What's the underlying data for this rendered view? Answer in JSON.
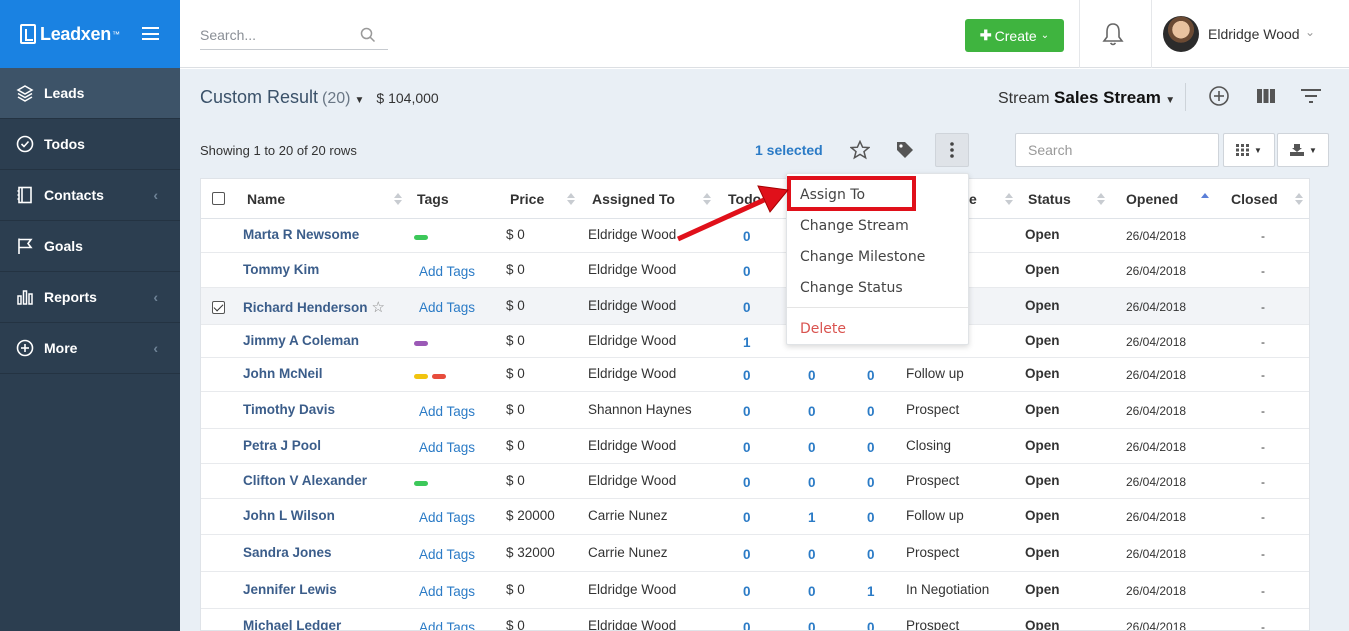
{
  "brand": {
    "name": "Leadxen",
    "tm": "™"
  },
  "sidebar": {
    "items": [
      {
        "label": "Leads",
        "icon": "layers-icon",
        "active": true
      },
      {
        "label": "Todos",
        "icon": "check-circle-icon",
        "active": false
      },
      {
        "label": "Contacts",
        "icon": "contact-book-icon",
        "active": false,
        "expandable": true
      },
      {
        "label": "Goals",
        "icon": "flag-icon",
        "active": false
      },
      {
        "label": "Reports",
        "icon": "bar-chart-icon",
        "active": false,
        "expandable": true
      },
      {
        "label": "More",
        "icon": "plus-circle-icon",
        "active": false,
        "expandable": true
      }
    ]
  },
  "topbar": {
    "search_placeholder": "Search...",
    "create_label": "Create",
    "user_name": "Eldridge Wood"
  },
  "header": {
    "title": "Custom Result",
    "count": "(20)",
    "amount": "$ 104,000",
    "stream_prefix": "Stream",
    "stream_name": "Sales Stream"
  },
  "toolbar": {
    "showing": "Showing 1 to 20 of 20 rows",
    "selected": "1 selected",
    "search_placeholder": "Search"
  },
  "table": {
    "columns": [
      "Name",
      "Tags",
      "Price",
      "Assigned To",
      "Todo",
      "",
      "",
      "Milestone",
      "Status",
      "Opened",
      "Closed"
    ],
    "column_labels": {
      "name": "Name",
      "tags": "Tags",
      "price": "Price",
      "assigned": "Assigned To",
      "todo": "Todo",
      "milestone_tail": "e",
      "status": "Status",
      "opened": "Opened",
      "closed": "Closed"
    },
    "add_tags_label": "Add Tags",
    "rows": [
      {
        "name": "Marta R Newsome",
        "tags": [
          "#3cc85a"
        ],
        "price": "$ 0",
        "assigned": "Eldridge Wood",
        "todo": "0",
        "c2": "",
        "c3": "",
        "milestone": "",
        "status": "Open",
        "opened": "26/04/2018",
        "closed": "-"
      },
      {
        "name": "Tommy Kim",
        "tags": [],
        "price": "$ 0",
        "assigned": "Eldridge Wood",
        "todo": "0",
        "c2": "",
        "c3": "",
        "milestone": "",
        "status": "Open",
        "opened": "26/04/2018",
        "closed": "-"
      },
      {
        "name": "Richard Henderson",
        "tags": [],
        "price": "$ 0",
        "assigned": "Eldridge Wood",
        "todo": "0",
        "c2": "",
        "c3": "",
        "milestone": "",
        "status": "Open",
        "opened": "26/04/2018",
        "closed": "-",
        "selected": true
      },
      {
        "name": "Jimmy A Coleman",
        "tags": [
          "#9b59b6"
        ],
        "price": "$ 0",
        "assigned": "Eldridge Wood",
        "todo": "1",
        "c2": "",
        "c3": "",
        "milestone": "",
        "status": "Open",
        "opened": "26/04/2018",
        "closed": "-"
      },
      {
        "name": "John McNeil",
        "tags": [
          "#f1c40f",
          "#e74c3c"
        ],
        "price": "$ 0",
        "assigned": "Eldridge Wood",
        "todo": "0",
        "c2": "0",
        "c3": "0",
        "milestone": "Follow up",
        "status": "Open",
        "opened": "26/04/2018",
        "closed": "-"
      },
      {
        "name": "Timothy Davis",
        "tags": [],
        "price": "$ 0",
        "assigned": "Shannon Haynes",
        "todo": "0",
        "c2": "0",
        "c3": "0",
        "milestone": "Prospect",
        "status": "Open",
        "opened": "26/04/2018",
        "closed": "-"
      },
      {
        "name": "Petra J Pool",
        "tags": [],
        "price": "$ 0",
        "assigned": "Eldridge Wood",
        "todo": "0",
        "c2": "0",
        "c3": "0",
        "milestone": "Closing",
        "status": "Open",
        "opened": "26/04/2018",
        "closed": "-"
      },
      {
        "name": "Clifton V Alexander",
        "tags": [
          "#3cc85a"
        ],
        "price": "$ 0",
        "assigned": "Eldridge Wood",
        "todo": "0",
        "c2": "0",
        "c3": "0",
        "milestone": "Prospect",
        "status": "Open",
        "opened": "26/04/2018",
        "closed": "-"
      },
      {
        "name": "John L Wilson",
        "tags": [],
        "price": "$ 20000",
        "assigned": "Carrie Nunez",
        "todo": "0",
        "c2": "1",
        "c3": "0",
        "milestone": "Follow up",
        "status": "Open",
        "opened": "26/04/2018",
        "closed": "-"
      },
      {
        "name": "Sandra Jones",
        "tags": [],
        "price": "$ 32000",
        "assigned": "Carrie Nunez",
        "todo": "0",
        "c2": "0",
        "c3": "0",
        "milestone": "Prospect",
        "status": "Open",
        "opened": "26/04/2018",
        "closed": "-"
      },
      {
        "name": "Jennifer Lewis",
        "tags": [],
        "price": "$ 0",
        "assigned": "Eldridge Wood",
        "todo": "0",
        "c2": "0",
        "c3": "1",
        "milestone": "In Negotiation",
        "status": "Open",
        "opened": "26/04/2018",
        "closed": "-"
      },
      {
        "name": "Michael Ledger",
        "tags": [],
        "price": "$ 0",
        "assigned": "Eldridge Wood",
        "todo": "0",
        "c2": "0",
        "c3": "0",
        "milestone": "Prospect",
        "status": "Open",
        "opened": "26/04/2018",
        "closed": "-"
      }
    ]
  },
  "menu": {
    "items": [
      "Assign To",
      "Change Stream",
      "Change Milestone",
      "Change Status"
    ],
    "delete": "Delete"
  },
  "colors": {
    "brand_blue": "#1a82e2",
    "sidebar": "#2c3e50",
    "create_green": "#3fb43f",
    "highlight_red": "#e0101a",
    "link_blue": "#2b7bc6"
  }
}
